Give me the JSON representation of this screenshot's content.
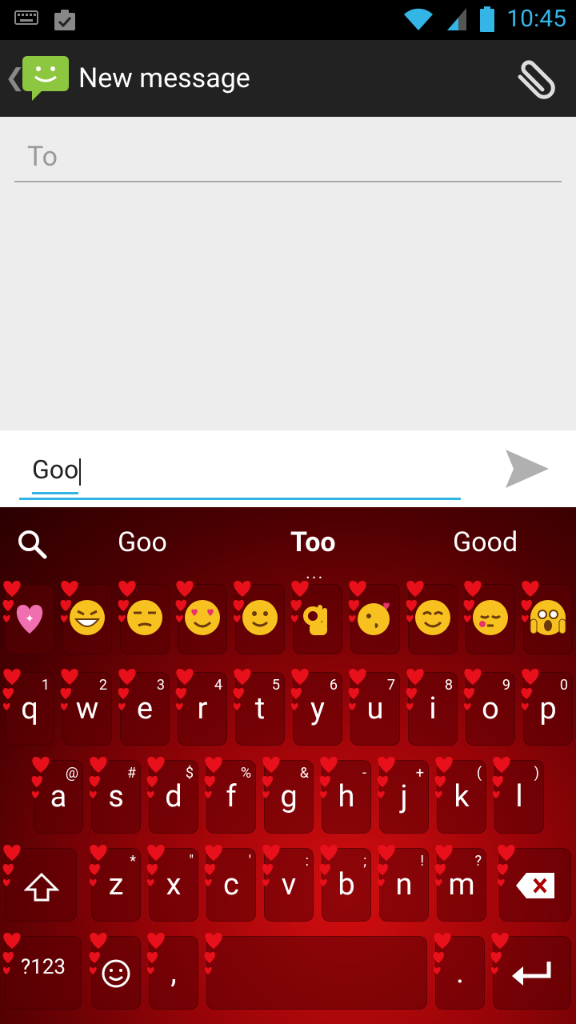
{
  "status_bar": {
    "time": "10:45"
  },
  "action_bar": {
    "title": "New message"
  },
  "compose": {
    "to_placeholder": "To",
    "message_text": "Goo"
  },
  "keyboard": {
    "suggestions": [
      "Goo",
      "Too",
      "Good"
    ],
    "suggestion_more": "...",
    "row1": [
      {
        "k": "q",
        "s": "1"
      },
      {
        "k": "w",
        "s": "2"
      },
      {
        "k": "e",
        "s": "3"
      },
      {
        "k": "r",
        "s": "4"
      },
      {
        "k": "t",
        "s": "5"
      },
      {
        "k": "y",
        "s": "6"
      },
      {
        "k": "u",
        "s": "7"
      },
      {
        "k": "i",
        "s": "8"
      },
      {
        "k": "o",
        "s": "9"
      },
      {
        "k": "p",
        "s": "0"
      }
    ],
    "row2": [
      {
        "k": "a",
        "s": "@"
      },
      {
        "k": "s",
        "s": "#"
      },
      {
        "k": "d",
        "s": "$"
      },
      {
        "k": "f",
        "s": "%"
      },
      {
        "k": "g",
        "s": "&"
      },
      {
        "k": "h",
        "s": "-"
      },
      {
        "k": "j",
        "s": "+"
      },
      {
        "k": "k",
        "s": "("
      },
      {
        "k": "l",
        "s": ")"
      }
    ],
    "row3": [
      {
        "k": "z",
        "s": "*"
      },
      {
        "k": "x",
        "s": "\""
      },
      {
        "k": "c",
        "s": "'"
      },
      {
        "k": "v",
        "s": ":"
      },
      {
        "k": "b",
        "s": ";"
      },
      {
        "k": "n",
        "s": "!"
      },
      {
        "k": "m",
        "s": "?"
      }
    ],
    "symbols_label": "?123",
    "comma_label": ",",
    "period_label": ".",
    "emoji_row": [
      "sparkling-heart",
      "grinning-squinting",
      "unamused",
      "heart-eyes",
      "slightly-smiling",
      "ok-hand",
      "kissing-heart",
      "smiling",
      "sleepy",
      "screaming"
    ]
  },
  "colors": {
    "accent": "#33b5e5",
    "keyboard_red": "#c00a0e",
    "action_bar": "#222222"
  }
}
